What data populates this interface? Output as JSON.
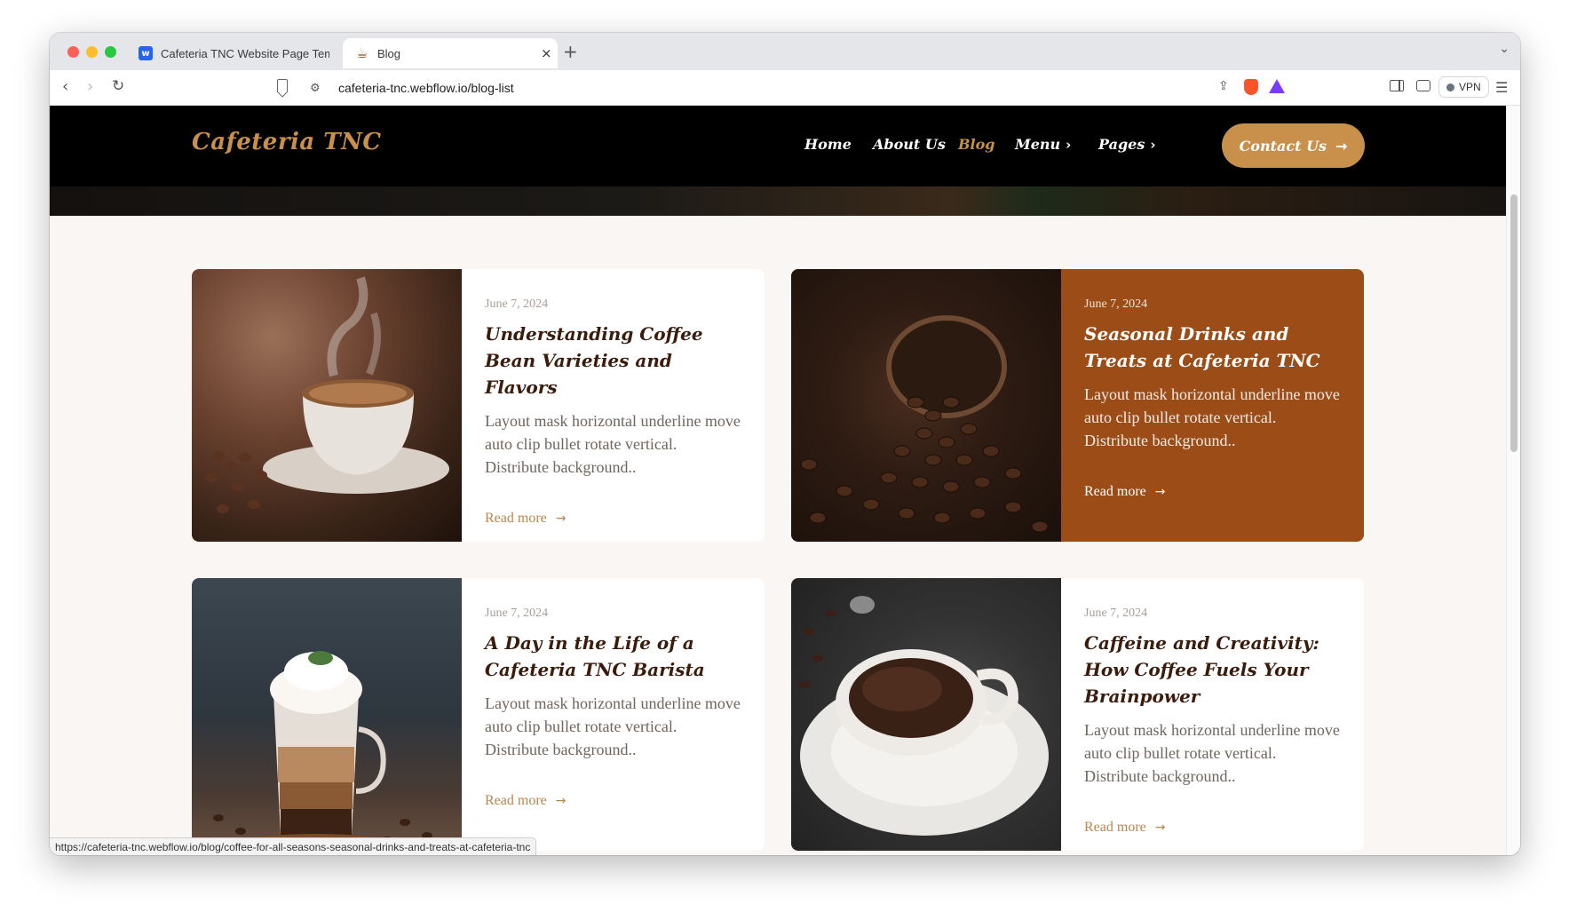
{
  "browser": {
    "tabs": [
      {
        "title": "Cafeteria TNC Website Page Temp",
        "icon": "webflow-icon",
        "active": false
      },
      {
        "title": "Blog",
        "icon": "coffee-cup-icon",
        "active": true
      }
    ],
    "new_tab_symbol": "+",
    "url": "cafeteria-tnc.webflow.io/blog-list",
    "vpn_label": "VPN",
    "status_url": "https://cafeteria-tnc.webflow.io/blog/coffee-for-all-seasons-seasonal-drinks-and-treats-at-cafeteria-tnc"
  },
  "site": {
    "logo": "Cafeteria TNC",
    "nav": [
      {
        "label": "Home",
        "active": false
      },
      {
        "label": "About Us",
        "active": false
      },
      {
        "label": "Blog",
        "active": true
      },
      {
        "label": "Menu",
        "has_submenu": true
      },
      {
        "label": "Pages",
        "has_submenu": true
      }
    ],
    "contact_button": "Contact Us",
    "accent_color": "#c8904a",
    "featured_color": "#9b4c17"
  },
  "posts": [
    {
      "date": "June 7, 2024",
      "title": "Understanding Coffee Bean Varieties and Flavors",
      "excerpt": "Layout mask horizontal underline move auto clip bullet rotate vertical. Distribute background..",
      "link": "Read more",
      "image": "steaming coffee cup with beans"
    },
    {
      "date": "June 7, 2024",
      "title": "Seasonal Drinks and Treats at Cafeteria TNC",
      "excerpt": "Layout mask horizontal underline move auto clip bullet rotate vertical. Distribute background..",
      "link": "Read more",
      "image": "bowl spilling coffee beans"
    },
    {
      "date": "June 7, 2024",
      "title": "A Day in the Life of a Cafeteria TNC Barista",
      "excerpt": "Layout mask horizontal underline move auto clip bullet rotate vertical. Distribute background..",
      "link": "Read more",
      "image": "layered latte with whipped cream"
    },
    {
      "date": "June 7, 2024",
      "title": "Caffeine and Creativity: How Coffee Fuels Your Brainpower",
      "excerpt": "Layout mask horizontal underline move auto clip bullet rotate vertical. Distribute background..",
      "link": "Read more",
      "image": "espresso cup on saucer"
    }
  ]
}
